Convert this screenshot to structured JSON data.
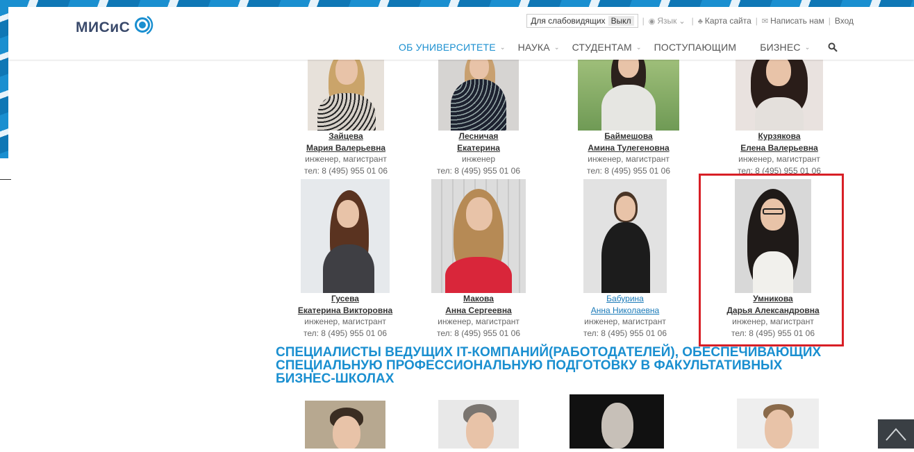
{
  "header": {
    "logo_text": "МИСиС",
    "util": {
      "low_vision_label": "Для слабовидящих",
      "low_vision_state": "Выкл",
      "language": "Язык",
      "sitemap": "Карта сайта",
      "write_us": "Написать нам",
      "login": "Вход"
    },
    "nav": [
      {
        "label": "ОБ УНИВЕРСИТЕТЕ",
        "active": true
      },
      {
        "label": "НАУКА"
      },
      {
        "label": "СТУДЕНТАМ"
      },
      {
        "label": "ПОСТУПАЮЩИМ"
      },
      {
        "label": "БИЗНЕС"
      }
    ]
  },
  "people_row1": [
    {
      "surname": "Зайцева",
      "name": "Мария Валерьевна",
      "role": "инженер, магистрант",
      "phone": "тел: 8 (495) 955 01 06"
    },
    {
      "surname": "Лесничая",
      "name": "Екатерина",
      "role": "инженер",
      "phone": "тел: 8 (495) 955 01 06"
    },
    {
      "surname": "Баймешова",
      "name": "Амина Тулегеновна",
      "role": "инженер, магистрант",
      "phone": "тел: 8 (495) 955 01 06"
    },
    {
      "surname": "Курзякова",
      "name": "Елена Валерьевна",
      "role": "инженер, магистрант",
      "phone": "тел: 8 (495) 955 01 06"
    }
  ],
  "people_row2": [
    {
      "surname": "Гусева",
      "name": "Екатерина Викторовна",
      "role": "инженер, магистрант",
      "phone": "тел: 8 (495) 955 01 06"
    },
    {
      "surname": "Макова",
      "name": "Анна Сергеевна",
      "role": "инженер, магистрант",
      "phone": "тел: 8 (495) 955 01 06"
    },
    {
      "surname": "Бабурина",
      "name": "Анна Николаевна",
      "role": "инженер, магистрант",
      "phone": "тел: 8 (495) 955 01 06"
    },
    {
      "surname": "Умникова",
      "name": "Дарья Александровна",
      "role": "инженер, магистрант",
      "phone": "тел: 8 (495) 955 01 06"
    }
  ],
  "section_title": "СПЕЦИАЛИСТЫ ВЕДУЩИХ IT-КОМПАНИЙ(РАБОТОДАТЕЛЕЙ), ОБЕСПЕЧИВАЮЩИХ СПЕЦИАЛЬНУЮ ПРОФЕССИОНАЛЬНУЮ ПОДГОТОВКУ В ФАКУЛЬТАТИВНЫХ БИЗНЕС-ШКОЛАХ",
  "colors": {
    "accent": "#1a8fd0",
    "highlight": "#d81f26"
  }
}
